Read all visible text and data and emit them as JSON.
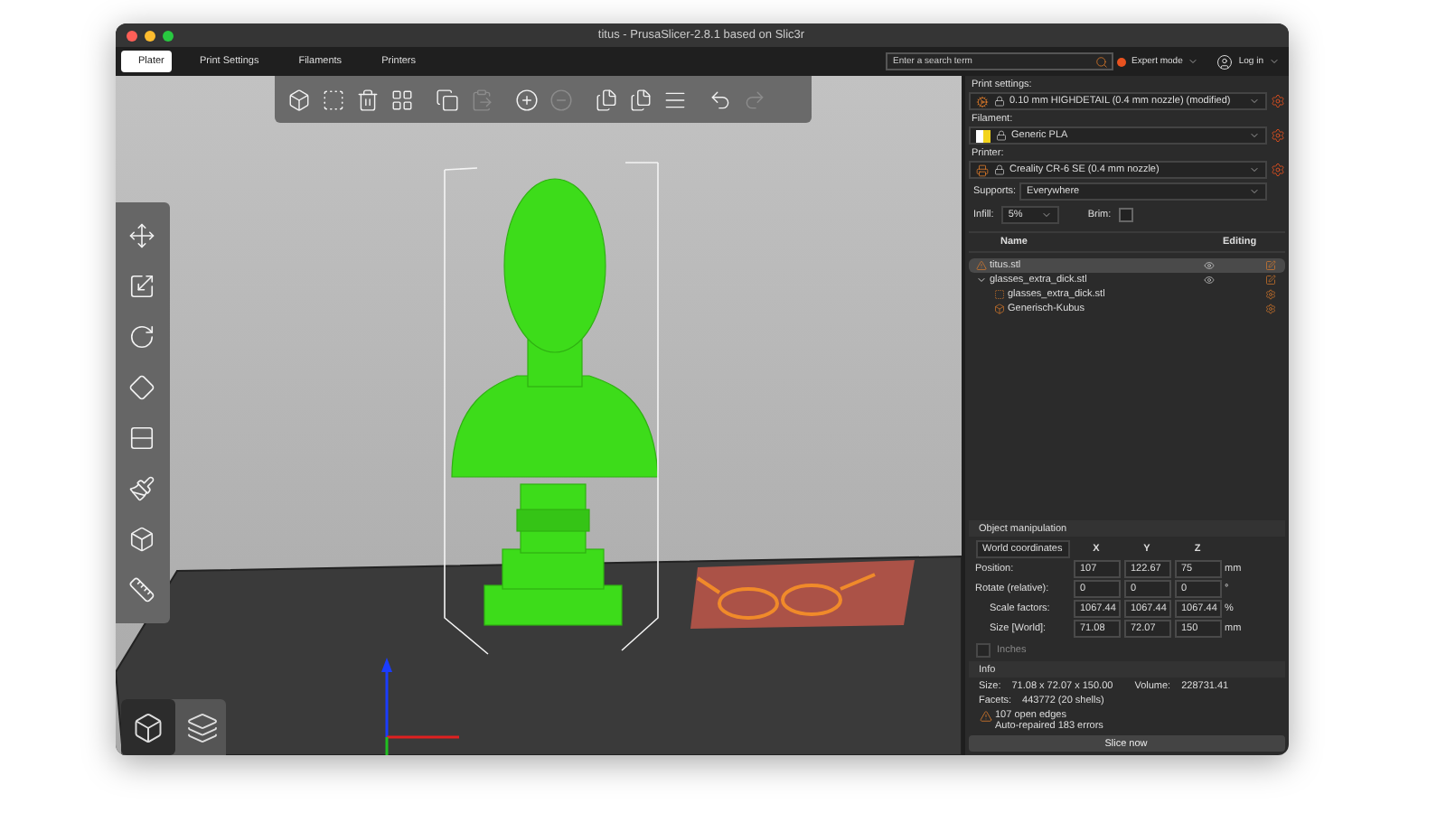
{
  "window": {
    "title": "titus - PrusaSlicer-2.8.1 based on Slic3r"
  },
  "tabs": [
    {
      "label": "Plater",
      "selected": true
    },
    {
      "label": "Print Settings",
      "selected": false
    },
    {
      "label": "Filaments",
      "selected": false
    },
    {
      "label": "Printers",
      "selected": false
    }
  ],
  "search": {
    "placeholder": "Enter a search term"
  },
  "mode": {
    "label": "Expert mode",
    "color": "#e8521f"
  },
  "account": {
    "label": "Log in"
  },
  "toolbar": [
    {
      "kind": "add",
      "disabled": false
    },
    {
      "kind": "delete",
      "disabled": false
    },
    {
      "kind": "delete_all",
      "disabled": false
    },
    {
      "kind": "arrange",
      "disabled": false
    },
    {
      "kind": "copy",
      "disabled": false
    },
    {
      "kind": "paste",
      "disabled": true
    },
    {
      "kind": "add_instance",
      "disabled": false
    },
    {
      "kind": "remove_instance",
      "disabled": true
    },
    {
      "kind": "split_objects",
      "disabled": false
    },
    {
      "kind": "split_parts",
      "disabled": false
    },
    {
      "kind": "layers",
      "disabled": false
    },
    {
      "kind": "undo",
      "disabled": false
    },
    {
      "kind": "redo",
      "disabled": true
    }
  ],
  "view_buttons": [
    {
      "kind": "model",
      "selected": true
    },
    {
      "kind": "preview",
      "selected": false
    }
  ],
  "presets": [
    {
      "kind": "print",
      "label": "Print settings:",
      "value": "0.10 mm HIGHDETAIL (0.4 mm nozzle) (modified)"
    },
    {
      "kind": "filament",
      "label": "Filament:",
      "value": "Generic PLA",
      "color": "#f2d31b"
    },
    {
      "kind": "printer",
      "label": "Printer:",
      "value": "Creality CR-6 SE (0.4 mm nozzle)"
    }
  ],
  "supports": {
    "label": "Supports:",
    "value": "Everywhere"
  },
  "infill": {
    "label": "Infill:",
    "value": "5%"
  },
  "brim": {
    "label": "Brim:",
    "checked": false
  },
  "object_list": {
    "columns": [
      "Name",
      "Editing"
    ],
    "items": [
      {
        "kind": "object",
        "name": "titus.stl",
        "selected": true,
        "warning": true,
        "visible": true
      },
      {
        "kind": "object",
        "name": "glasses_extra_dick.stl",
        "selected": false,
        "visible": true,
        "expanded": true,
        "children": [
          {
            "kind": "part",
            "name": "glasses_extra_dick.stl",
            "selected": false
          },
          {
            "kind": "modifier",
            "name": "Generisch-Kubus",
            "selected": false
          }
        ]
      }
    ]
  },
  "manipulation": {
    "title": "Object manipulation",
    "coordinates": "World coordinates",
    "axes": [
      "X",
      "Y",
      "Z"
    ],
    "rows": [
      {
        "label": "Position:",
        "values": [
          "107",
          "122.67",
          "75"
        ],
        "unit": "mm"
      },
      {
        "label": "Rotate (relative):",
        "values": [
          "0",
          "0",
          "0"
        ],
        "unit": "°"
      },
      {
        "label": "Scale factors:",
        "values": [
          "1067.44",
          "1067.44",
          "1067.44"
        ],
        "unit": "%"
      },
      {
        "label": "Size [World]:",
        "values": [
          "71.08",
          "72.07",
          "150"
        ],
        "unit": "mm"
      }
    ],
    "inches": {
      "label": "Inches",
      "checked": false,
      "disabled": true
    }
  },
  "info": {
    "title": "Info",
    "size_label": "Size:",
    "size": "71.08 x 72.07 x 150.00",
    "volume_label": "Volume:",
    "volume": "228731.41",
    "facets_label": "Facets:",
    "facets": "443772 (20 shells)",
    "warnings": [
      "107 open edges",
      "Auto-repaired 183 errors"
    ]
  },
  "slice_button": {
    "label": "Slice now"
  }
}
